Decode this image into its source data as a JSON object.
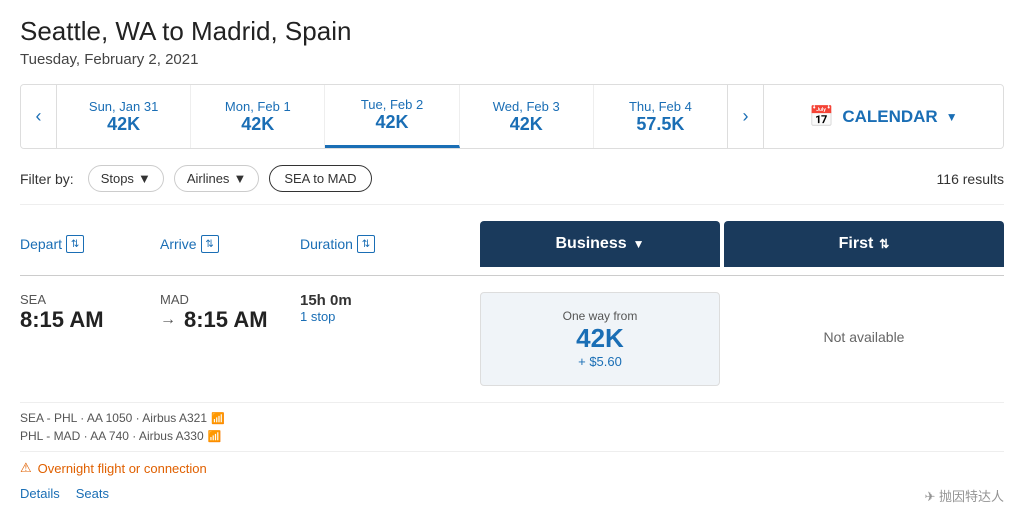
{
  "page": {
    "title": "Seattle, WA to Madrid, Spain",
    "subtitle": "Tuesday, February 2, 2021",
    "results_count": "116 results"
  },
  "date_nav": {
    "prev_arrow": "‹",
    "next_arrow": "›",
    "dates": [
      {
        "label": "Sun, Jan 31",
        "points": "42K",
        "active": false
      },
      {
        "label": "Mon, Feb 1",
        "points": "42K",
        "active": false
      },
      {
        "label": "Tue, Feb 2",
        "points": "42K",
        "active": true
      },
      {
        "label": "Wed, Feb 3",
        "points": "42K",
        "active": false
      },
      {
        "label": "Thu, Feb 4",
        "points": "57.5K",
        "active": false
      }
    ],
    "calendar_label": "CALENDAR"
  },
  "filters": {
    "label": "Filter by:",
    "stops_label": "Stops",
    "airlines_label": "Airlines",
    "route_tag": "SEA to MAD"
  },
  "table_headers": {
    "depart": "Depart",
    "arrive": "Arrive",
    "duration": "Duration",
    "business": "Business",
    "first": "First"
  },
  "flights": [
    {
      "depart_code": "SEA",
      "depart_time": "8:15 AM",
      "arrive_code": "MAD",
      "arrive_time": "8:15 AM",
      "duration": "15h 0m",
      "stops": "1 stop",
      "business_label": "One way from",
      "business_points": "42K",
      "business_cash": "+ $5.60",
      "first_text": "Not available",
      "segments": [
        "SEA - PHL  ·  AA 1050  ·  Airbus A321",
        "PHL - MAD  ·  AA 740  ·  Airbus A330"
      ],
      "warning": "Overnight flight or connection",
      "actions": [
        "Details",
        "Seats"
      ]
    }
  ],
  "watermark": "✈ 抛因特达人"
}
